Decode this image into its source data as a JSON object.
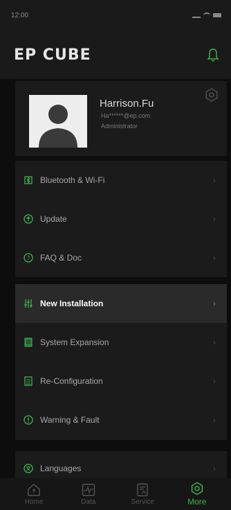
{
  "status_bar": {
    "time": "12:00"
  },
  "header": {
    "logo": "EP CUBE",
    "notification_icon": "bell-icon"
  },
  "colors": {
    "accent": "#3fb34f",
    "background": "#0d0d0d",
    "card": "#1b1b1b"
  },
  "profile": {
    "name": "Harrison.Fu",
    "email": "Ha******@ep.com",
    "role": "Administrator",
    "settings_icon": "gear-icon"
  },
  "menu_group_1": [
    {
      "label": "Bluetooth & Wi-Fi",
      "icon": "bluetooth-wifi-icon"
    },
    {
      "label": "Update",
      "icon": "update-icon"
    },
    {
      "label": "FAQ & Doc",
      "icon": "faq-icon"
    }
  ],
  "menu_group_2": [
    {
      "label": "New Installation",
      "icon": "installation-icon",
      "selected": true
    },
    {
      "label": "System Expansion",
      "icon": "expansion-icon"
    },
    {
      "label": "Re-Configuration",
      "icon": "reconfiguration-icon"
    },
    {
      "label": "Warning & Fault",
      "icon": "warning-icon"
    }
  ],
  "menu_group_3": [
    {
      "label": "Languages",
      "icon": "language-icon"
    }
  ],
  "tabbar": [
    {
      "label": "Home",
      "icon": "home-icon"
    },
    {
      "label": "Data",
      "icon": "data-icon"
    },
    {
      "label": "Service",
      "icon": "service-icon"
    },
    {
      "label": "More",
      "icon": "more-gear-icon",
      "active": true
    }
  ]
}
